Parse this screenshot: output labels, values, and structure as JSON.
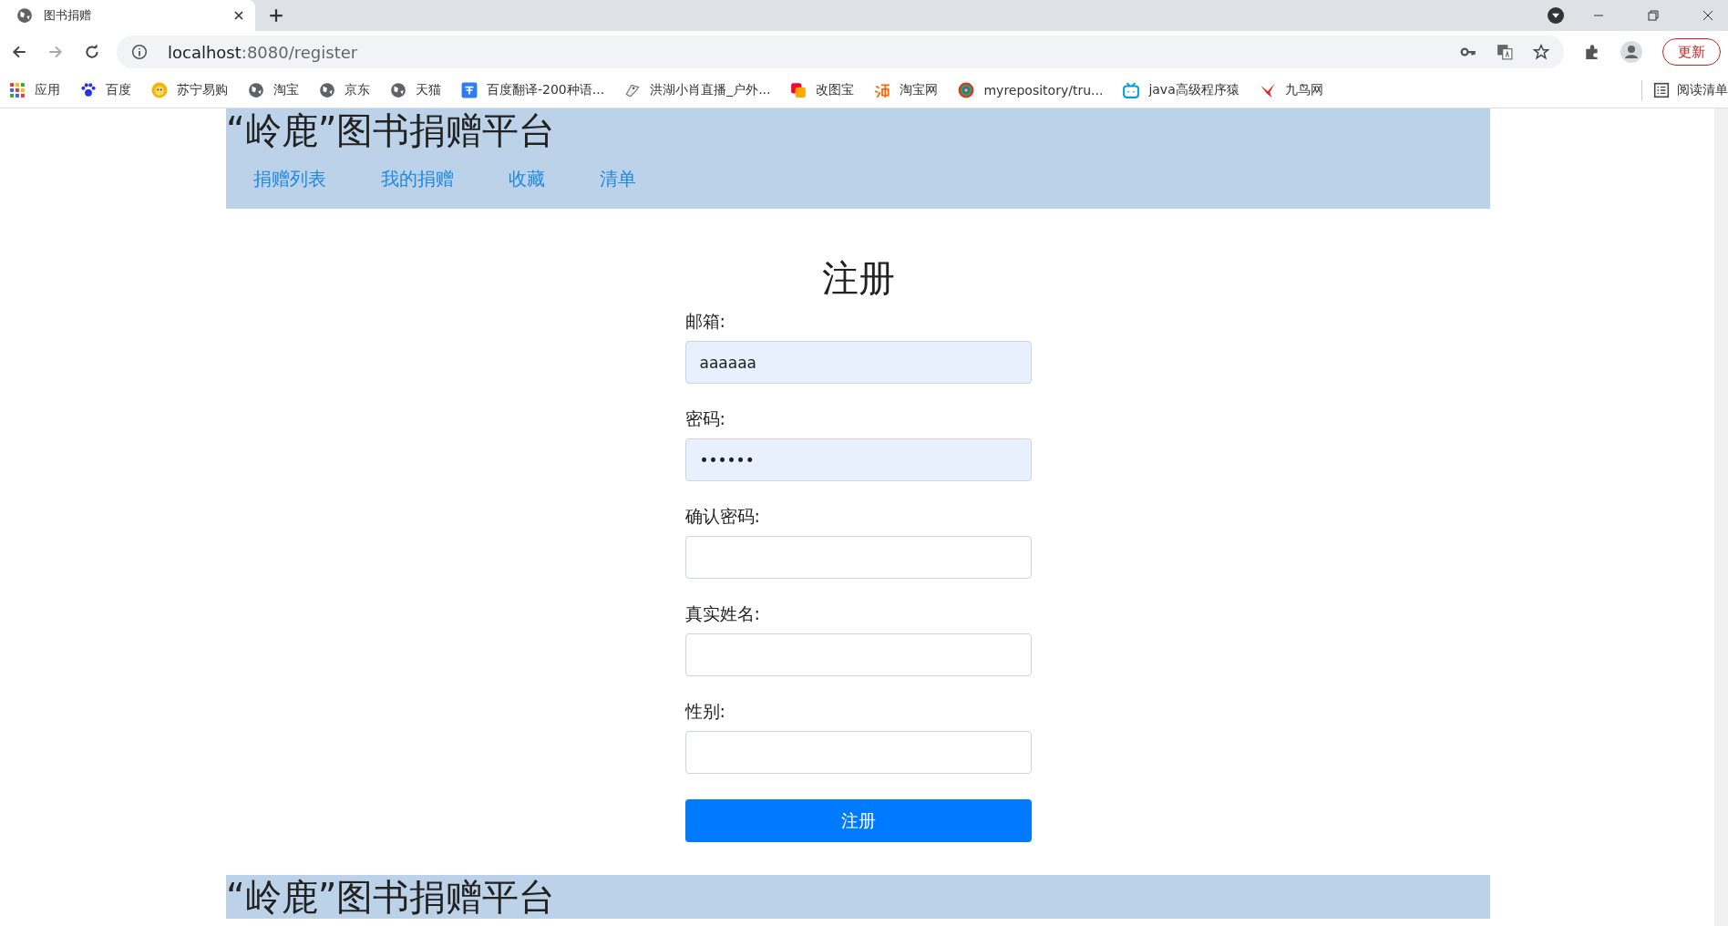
{
  "browser": {
    "tab_title": "图书捐赠",
    "url_host": "localhost",
    "url_path": ":8080/register",
    "update_button": "更新",
    "bookmarks": [
      {
        "label": "应用"
      },
      {
        "label": "百度"
      },
      {
        "label": "苏宁易购"
      },
      {
        "label": "淘宝"
      },
      {
        "label": "京东"
      },
      {
        "label": "天猫"
      },
      {
        "label": "百度翻译-200种语..."
      },
      {
        "label": "洪湖小肖直播_户外..."
      },
      {
        "label": "改图宝"
      },
      {
        "label": "淘宝网"
      },
      {
        "label": "myrepository/tru..."
      },
      {
        "label": "java高级程序猿"
      },
      {
        "label": "九鸟网"
      }
    ],
    "reading_list": "阅读清单"
  },
  "header": {
    "title": "“岭鹿”图书捐赠平台",
    "nav": [
      "捐赠列表",
      "我的捐赠",
      "收藏",
      "清单"
    ]
  },
  "form": {
    "title": "注册",
    "fields": [
      {
        "label": "邮箱:",
        "value": "aaaaaa",
        "autofilled": true
      },
      {
        "label": "密码:",
        "value": "••••••",
        "autofilled": true
      },
      {
        "label": "确认密码:",
        "autofilled": false
      },
      {
        "label": "真实姓名:",
        "autofilled": false
      },
      {
        "label": "性别:",
        "autofilled": false
      }
    ],
    "submit": "注册"
  },
  "footer": {
    "title": "“岭鹿”图书捐赠平台"
  }
}
